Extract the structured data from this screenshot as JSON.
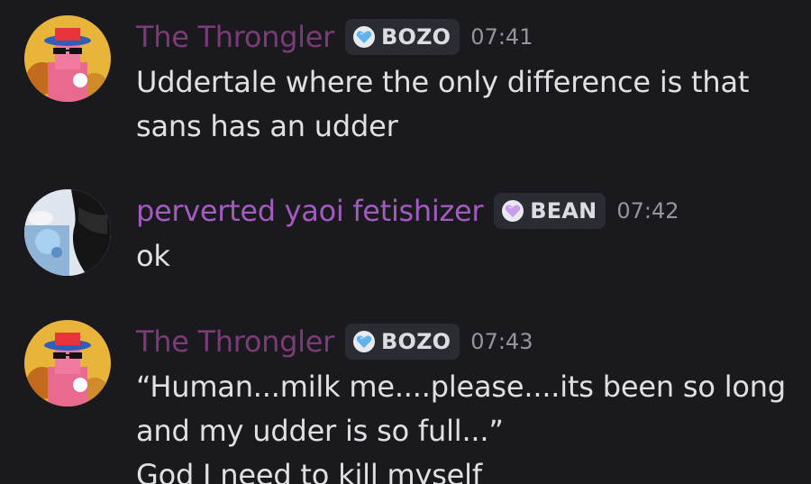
{
  "messages": [
    {
      "username": "The Throngler",
      "tag": "BOZO",
      "tag_icon": "blue-heart-icon",
      "timestamp": "07:41",
      "lines": [
        "Uddertale where the only difference is that",
        "sans has an udder"
      ]
    },
    {
      "username": "perverted yaoi fetishizer",
      "tag": "BEAN",
      "tag_icon": "purple-heart-icon",
      "timestamp": "07:42",
      "lines": [
        "ok"
      ]
    },
    {
      "username": "The Throngler",
      "tag": "BOZO",
      "tag_icon": "blue-heart-icon",
      "timestamp": "07:43",
      "lines": [
        "“Human...milk me....please....its been so long",
        "and my udder is so full...”",
        "God I need to kill myself"
      ]
    }
  ],
  "colors": {
    "background": "#1a1a1e",
    "username_throngler": "#7b3b78",
    "username_perverted": "#a35bc0",
    "tag_bg": "#2b2c33",
    "blue_heart": "#5fb4f0",
    "purple_heart": "#c89cf0"
  }
}
